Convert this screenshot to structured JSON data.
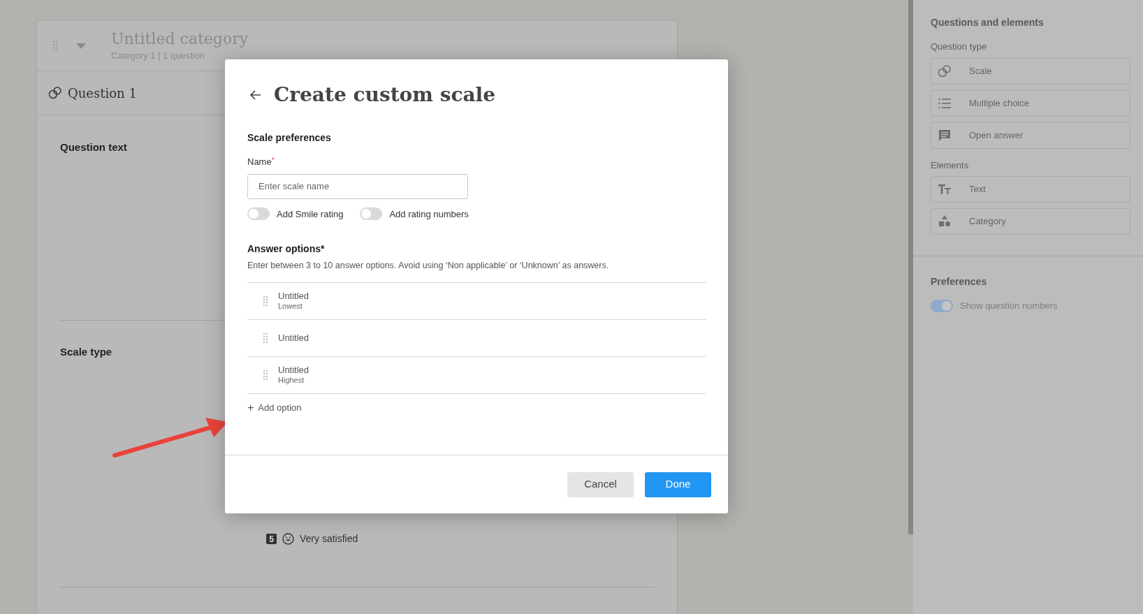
{
  "category": {
    "title": "Untitled category",
    "subtitle": "Category 1 | 1 question"
  },
  "question": {
    "title": "Question 1",
    "sections": [
      {
        "label": "Question text"
      },
      {
        "label": "Scale type"
      }
    ],
    "scale_items": [
      {
        "number": "5",
        "label": "Very satisfied"
      }
    ]
  },
  "sidebar": {
    "title": "Questions and elements",
    "groups": [
      {
        "label": "Question type",
        "items": [
          {
            "label": "Scale",
            "kind": "scale"
          },
          {
            "label": "Multiple choice",
            "kind": "list"
          },
          {
            "label": "Open answer",
            "kind": "chat"
          }
        ]
      },
      {
        "label": "Elements",
        "items": [
          {
            "label": "Text",
            "kind": "text"
          },
          {
            "label": "Category",
            "kind": "shapes"
          }
        ]
      }
    ],
    "preferences": {
      "title": "Preferences",
      "toggles": [
        {
          "label": "Show question numbers",
          "on": true
        }
      ]
    }
  },
  "dialog": {
    "title": "Create custom scale",
    "section": "Scale preferences",
    "name_label": "Name",
    "required_mark": "*",
    "name_placeholder": "Enter scale name",
    "toggles": [
      {
        "label": "Add Smile rating",
        "on": false
      },
      {
        "label": "Add rating numbers",
        "on": false
      }
    ],
    "answer_title": "Answer options*",
    "answer_hint": "Enter between 3 to 10 answer options. Avoid using ‘Non applicable’ or ‘Unknown’ as answers.",
    "options": [
      {
        "label": "Untitled",
        "note": "Lowest"
      },
      {
        "label": "Untitled"
      },
      {
        "label": "Untitled",
        "note": "Highest"
      }
    ],
    "add_option": "Add option",
    "add_icon": "+",
    "buttons": [
      {
        "label": "Cancel",
        "kind": "secondary"
      },
      {
        "label": "Done",
        "kind": "primary"
      }
    ]
  }
}
